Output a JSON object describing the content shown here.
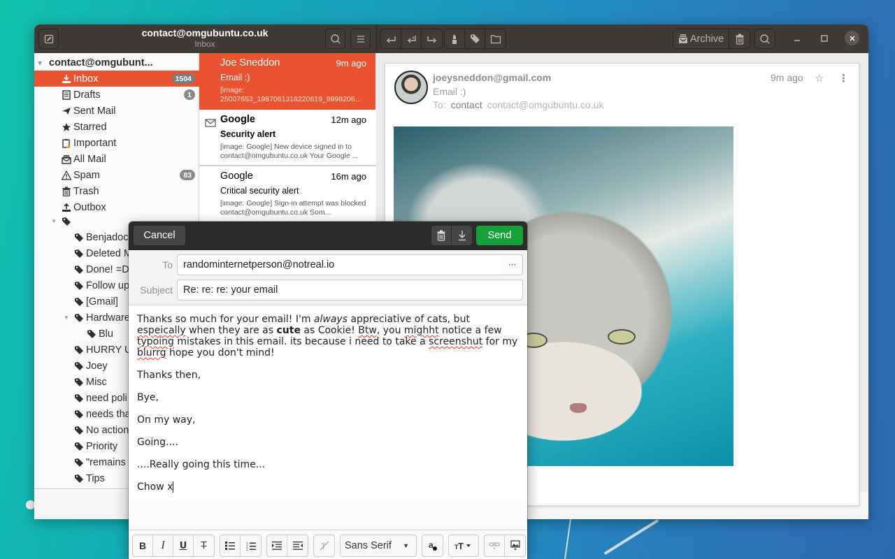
{
  "window": {
    "title": "contact@omgubuntu.co.uk",
    "subtitle": "Inbox",
    "toolbar": {
      "archive_label": "Archive"
    }
  },
  "sidebar": {
    "account": "contact@omgubunt...",
    "folders": [
      {
        "label": "Inbox",
        "icon": "inbox-download-icon",
        "badge": "1504",
        "selected": true
      },
      {
        "label": "Drafts",
        "icon": "drafts-icon",
        "badge": "1"
      },
      {
        "label": "Sent Mail",
        "icon": "sent-plane-icon",
        "badge": null
      },
      {
        "label": "Starred",
        "icon": "star-icon",
        "badge": null
      },
      {
        "label": "Important",
        "icon": "important-clipboard-icon",
        "badge": null
      },
      {
        "label": "All Mail",
        "icon": "all-mail-icon",
        "badge": null
      },
      {
        "label": "Spam",
        "icon": "warning-icon",
        "badge": "83"
      },
      {
        "label": "Trash",
        "icon": "trash-icon",
        "badge": null
      },
      {
        "label": "Outbox",
        "icon": "outbox-upload-icon",
        "badge": null
      }
    ],
    "labels": [
      {
        "label": "Benjadoc",
        "level": 1
      },
      {
        "label": "Deleted M",
        "level": 1
      },
      {
        "label": "Done! =D",
        "level": 1
      },
      {
        "label": "Follow up",
        "level": 1
      },
      {
        "label": "[Gmail]",
        "level": 1
      },
      {
        "label": "Hardware",
        "level": 1,
        "expanded": true
      },
      {
        "label": "Blu",
        "level": 2
      },
      {
        "label": "HURRY U",
        "level": 1
      },
      {
        "label": "Joey",
        "level": 1
      },
      {
        "label": "Misc",
        "level": 1
      },
      {
        "label": "need poli",
        "level": 1
      },
      {
        "label": "needs tha",
        "level": 1
      },
      {
        "label": "No action",
        "level": 1
      },
      {
        "label": "Priority",
        "level": 1
      },
      {
        "label": "\"remains",
        "level": 1
      },
      {
        "label": "Tips",
        "level": 1
      }
    ]
  },
  "messages": [
    {
      "from": "Joe Sneddon",
      "time": "9m ago",
      "subject": "Email :)",
      "preview": "[image: 25007653_1987061318220619_8998206...",
      "selected": true,
      "unread": false
    },
    {
      "from": "Google",
      "time": "12m ago",
      "subject": "Security alert",
      "preview": "[image: Google] New device signed in to contact@omgubuntu.co.uk Your Google ...",
      "selected": false,
      "unread": true
    },
    {
      "from": "Google",
      "time": "16m ago",
      "subject": "Critical security alert",
      "preview": "[image: Google] Sign-in attempt was blocked contact@omgubuntu.co.uk Som...",
      "selected": false,
      "unread": false
    }
  ],
  "reader": {
    "from": "joeysneddon@gmail.com",
    "subject": "Email :)",
    "to_prefix": "To:",
    "to_name": "contact",
    "to_address": "contact@omgubuntu.co.uk",
    "time": "9m ago",
    "star_glyph": "☆",
    "more_glyph": "⋮",
    "image_alt": "cat photo"
  },
  "compose": {
    "cancel_label": "Cancel",
    "send_label": "Send",
    "to_label": "To",
    "to_value": "randominternetperson@notreal.io",
    "to_more": "···",
    "subject_label": "Subject",
    "subject_value": "Re: re: re: your email",
    "body": {
      "p1": {
        "a": "Thanks so much for your email! I'm ",
        "b_italic": "always",
        "c": " appreciative of cats, but ",
        "d_misspelled": "espeically",
        "e": " when they are as ",
        "f_bold": "cute",
        "g": " as Cookie! ",
        "h_misspelled": "Btw",
        "i": ", you ",
        "j_misspelled": "mighht",
        "k": " notice a few ",
        "l_misspelled": "typoing",
        "m": " mistakes in this email. its because i need to take a ",
        "n_misspelled": "screenshut",
        "o": " for my ",
        "p_misspelled": "blurrg",
        "q": " hope you don't mind!"
      },
      "lines": [
        "Thanks then,",
        "Bye,",
        "On my way,",
        "Going....",
        "....Really going this time...",
        "Chow x"
      ]
    },
    "toolbar": {
      "bold": "B",
      "italic": "I",
      "underline": "U",
      "strike": "T",
      "font": "Sans Serif"
    }
  }
}
